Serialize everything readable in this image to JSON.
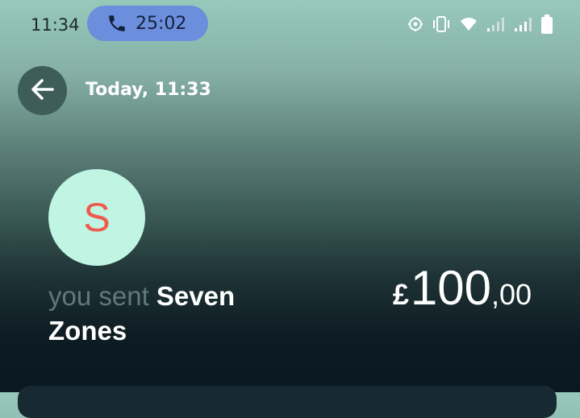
{
  "status_bar": {
    "time": "11:34",
    "call_timer": "25:02",
    "icons": [
      "call-phone-icon",
      "location-icon",
      "vibrate-icon",
      "wifi-icon",
      "signal-weak-icon",
      "signal-icon",
      "battery-icon"
    ]
  },
  "header": {
    "back_icon": "arrow-left-icon",
    "date": "Today, 11:33"
  },
  "transaction": {
    "avatar_letter": "S",
    "prefix": "you sent",
    "recipient": "Seven Zones",
    "amount": {
      "currency": "£",
      "whole": "100",
      "decimal": ",00"
    }
  },
  "colors": {
    "call_pill": "#6b8fdc",
    "avatar_bg": "#c0f4e3",
    "avatar_letter": "#ef5a4c",
    "prefix_text": "#62787d"
  }
}
